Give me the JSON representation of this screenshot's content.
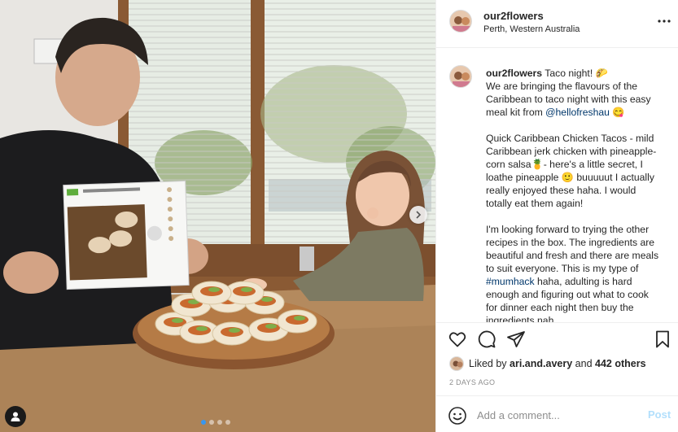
{
  "photo": {
    "next_icon": "chevron-right-icon",
    "tag_icon": "user-tag-icon",
    "slide_count": 4,
    "active_slide": 1
  },
  "header": {
    "username": "our2flowers",
    "location": "Perth, Western Australia",
    "more_icon": "ellipsis-icon"
  },
  "caption": {
    "username": "our2flowers",
    "line1": " Taco night! 🌮",
    "line1b": "We are bringing the flavours of the Caribbean to taco night with this easy meal kit from ",
    "mention": "@hellofreshau",
    "line1c": " 😋",
    "para2": "Quick Caribbean Chicken Tacos - mild Caribbean jerk chicken with pineapple-corn salsa🍍- here's a little secret, I loathe pineapple 🙂 buuuuut I actually really enjoyed these haha. I would totally eat them again!",
    "para3a": "I'm looking forward to trying the other recipes in the box. The ingredients are beautiful and fresh and there are meals to suit everyone. This is my type of ",
    "hashtag": "#mumhack",
    "para3b": " haha, adulting is hard enough and figuring out what to cook for dinner each night then buy the ingredients nah"
  },
  "actions": {
    "like_icon": "heart-icon",
    "comment_icon": "comment-icon",
    "share_icon": "paper-plane-icon",
    "save_icon": "bookmark-icon"
  },
  "likes": {
    "prefix": "Liked by ",
    "user": "ari.and.avery",
    "middle": " and ",
    "others": "442 others"
  },
  "date": "2 DAYS AGO",
  "comment_box": {
    "placeholder": "Add a comment...",
    "post_label": "Post",
    "emoji_icon": "smiley-icon"
  },
  "colors": {
    "link": "#00376b",
    "post_disabled": "#b2dffc",
    "muted": "#8e8e8e",
    "slide_active": "#3897f0"
  }
}
